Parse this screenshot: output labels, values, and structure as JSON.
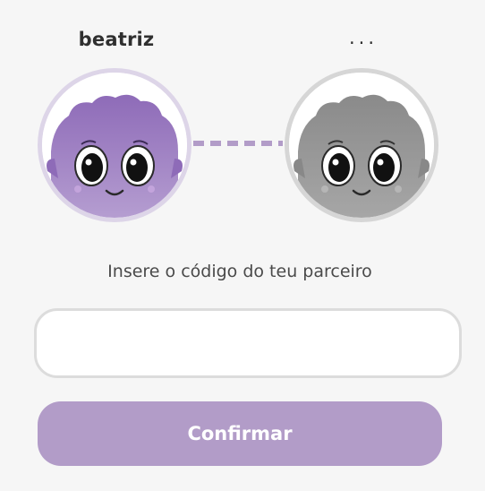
{
  "pairing": {
    "user_name": "beatriz",
    "partner_name": "...",
    "user_avatar": "purple-fluffy-monster",
    "partner_avatar": "grey-fluffy-monster",
    "prompt": "Insere o código do teu parceiro",
    "code_input": {
      "value": "",
      "placeholder": ""
    },
    "confirm_label": "Confirmar"
  },
  "colors": {
    "accent": "#b29cc8",
    "user_avatar": "#a084c4",
    "partner_avatar": "#9a9a9a",
    "connector": "#b29cc8"
  }
}
